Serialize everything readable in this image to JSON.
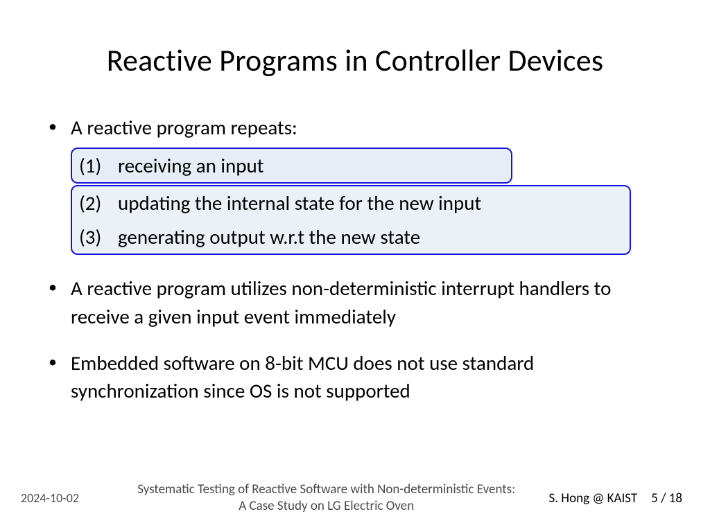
{
  "title": "Reactive Programs in Controller Devices",
  "bullets": {
    "b1": "A reactive program repeats:",
    "steps": {
      "n1": "(1)",
      "t1": "receiving an input",
      "n2": "(2)",
      "t2": "updating the internal state for the new input",
      "n3": "(3)",
      "t3": "generating output w.r.t the new state"
    },
    "b2": "A reactive program utilizes non-deterministic interrupt handlers to receive a given input event immediately",
    "b3": "Embedded software on 8-bit MCU does not use standard synchronization since OS is not supported"
  },
  "footer": {
    "date": "2024-10-02",
    "title_line1": "Systematic Testing of Reactive Software with Non-deterministic Events:",
    "title_line2": "A Case Study on LG Electric Oven",
    "author": "S. Hong @ KAIST",
    "page": "5 / 18"
  }
}
